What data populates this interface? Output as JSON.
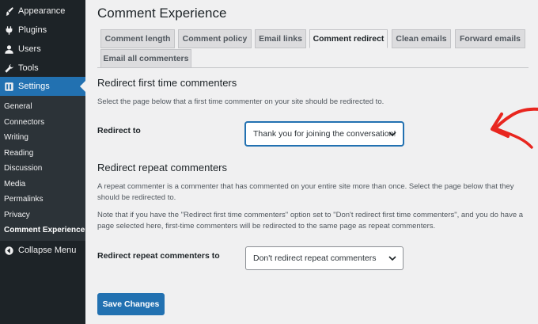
{
  "sidebar": {
    "top_items": [
      {
        "label": "Appearance",
        "icon": "paintbrush-icon"
      },
      {
        "label": "Plugins",
        "icon": "plugin-icon"
      },
      {
        "label": "Users",
        "icon": "user-icon"
      },
      {
        "label": "Tools",
        "icon": "wrench-icon"
      },
      {
        "label": "Settings",
        "icon": "settings-icon"
      }
    ],
    "submenu": [
      {
        "label": "General"
      },
      {
        "label": "Connectors"
      },
      {
        "label": "Writing"
      },
      {
        "label": "Reading"
      },
      {
        "label": "Discussion"
      },
      {
        "label": "Media"
      },
      {
        "label": "Permalinks"
      },
      {
        "label": "Privacy"
      },
      {
        "label": "Comment Experience"
      }
    ],
    "collapse_label": "Collapse Menu"
  },
  "page": {
    "title": "Comment Experience",
    "tabs": [
      {
        "label": "Comment length"
      },
      {
        "label": "Comment policy"
      },
      {
        "label": "Email links"
      },
      {
        "label": "Comment redirect"
      },
      {
        "label": "Clean emails"
      },
      {
        "label": "Forward emails"
      },
      {
        "label": "Email all commenters"
      }
    ],
    "first": {
      "title": "Redirect first time commenters",
      "description": "Select the page below that a first time commenter on your site should be redirected to.",
      "label": "Redirect to",
      "value": "Thank you for joining the conversation!"
    },
    "repeat": {
      "title": "Redirect repeat commenters",
      "description": "A repeat commenter is a commenter that has commented on your entire site more than once. Select the page below that they should be redirected to.",
      "note": "Note that if you have the \"Redirect first time commenters\" option set to \"Don't redirect first time commenters\", and you do have a page selected here, first-time commenters will be redirected to the same page as repeat commenters.",
      "label": "Redirect repeat commenters to",
      "value": "Don't redirect repeat commenters"
    },
    "save_label": "Save Changes"
  },
  "colors": {
    "accent": "#2271b1",
    "sidebar_bg": "#1d2327",
    "annotation": "#e8261f"
  }
}
